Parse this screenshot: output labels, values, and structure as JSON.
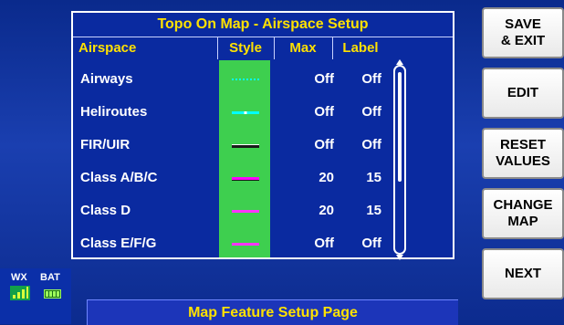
{
  "panel": {
    "title": "Topo On Map - Airspace Setup",
    "columns": {
      "airspace": "Airspace",
      "style": "Style",
      "max": "Max",
      "label": "Label"
    },
    "rows": [
      {
        "name": "Airways",
        "style_color": "#00ffff",
        "style_pattern": "dotted",
        "max": "Off",
        "label": "Off"
      },
      {
        "name": "Heliroutes",
        "style_color": "#00ffff",
        "style_pattern": "dash-dash",
        "max": "Off",
        "label": "Off"
      },
      {
        "name": "FIR/UIR",
        "style_color": "#333333",
        "style_pattern": "solid-gray",
        "max": "Off",
        "label": "Off"
      },
      {
        "name": "Class A/B/C",
        "style_color": "#ff00ff",
        "style_pattern": "solid-dark",
        "max": "20",
        "label": "15"
      },
      {
        "name": "Class D",
        "style_color": "#ff33ff",
        "style_pattern": "solid",
        "max": "20",
        "label": "15"
      },
      {
        "name": "Class E/F/G",
        "style_color": "#ff33ff",
        "style_pattern": "solid",
        "max": "Off",
        "label": "Off"
      }
    ]
  },
  "softkeys": [
    {
      "label": "SAVE\n& EXIT"
    },
    {
      "label": "EDIT"
    },
    {
      "label": "RESET\nVALUES"
    },
    {
      "label": "CHANGE\nMAP"
    },
    {
      "label": "NEXT"
    }
  ],
  "status": {
    "wx_label": "WX",
    "bat_label": "BAT"
  },
  "footer": {
    "text": "Map Feature Setup Page"
  },
  "colors": {
    "title": "#ffe100",
    "style_bg": "#3ecf4f",
    "panel_bg": "#0a2aa0"
  }
}
